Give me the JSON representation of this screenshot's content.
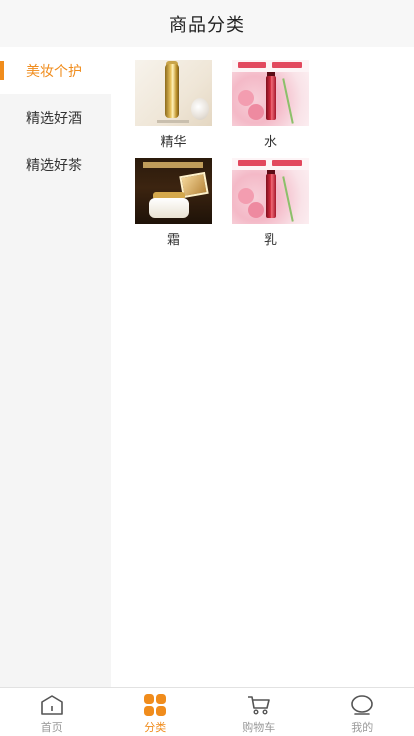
{
  "header": {
    "title": "商品分类"
  },
  "sidebar": {
    "items": [
      {
        "label": "美妆个护",
        "active": true
      },
      {
        "label": "精选好酒",
        "active": false
      },
      {
        "label": "精选好茶",
        "active": false
      }
    ]
  },
  "products": [
    {
      "name": "精华",
      "thumb": "gold-serum-bottle"
    },
    {
      "name": "水",
      "thumb": "pink-red-bottle"
    },
    {
      "name": "霜",
      "thumb": "cream-jar-dark"
    },
    {
      "name": "乳",
      "thumb": "pink-red-bottle"
    }
  ],
  "tabbar": {
    "tabs": [
      {
        "label": "首页",
        "icon": "home-icon",
        "active": false
      },
      {
        "label": "分类",
        "icon": "category-grid-icon",
        "active": true
      },
      {
        "label": "购物车",
        "icon": "cart-icon",
        "active": false
      },
      {
        "label": "我的",
        "icon": "profile-icon",
        "active": false
      }
    ]
  },
  "colors": {
    "accent": "#f08c1c",
    "inactive": "#999999",
    "sidebar_bg": "#f5f5f5",
    "header_bg": "#f7f7f7"
  }
}
